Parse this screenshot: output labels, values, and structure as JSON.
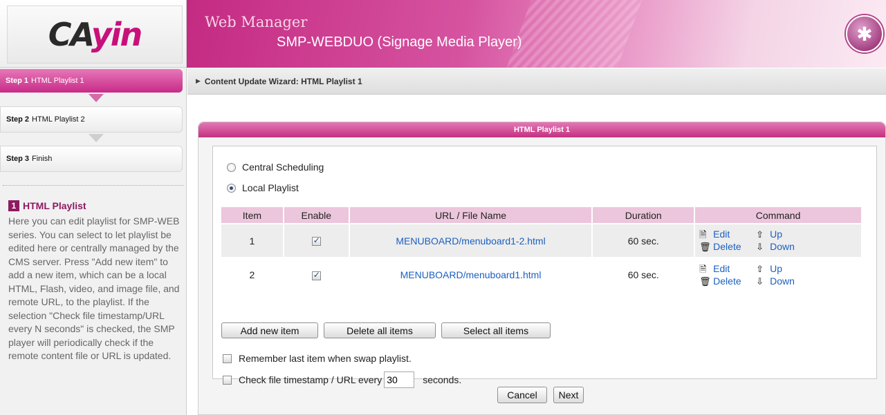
{
  "logo": {
    "text_left": "CA",
    "text_right": "yin"
  },
  "header": {
    "brand": "Web Manager",
    "model": "SMP-WEBDUO (Signage Media Player)",
    "emblem_icon": "cayin-emblem-icon"
  },
  "steps": [
    {
      "num": "Step 1",
      "label": "HTML Playlist 1",
      "active": true
    },
    {
      "num": "Step 2",
      "label": "HTML Playlist 2",
      "active": false
    },
    {
      "num": "Step 3",
      "label": "Finish",
      "active": false
    }
  ],
  "help": {
    "badge": "1",
    "title": "HTML Playlist",
    "body": "Here you can edit playlist for SMP-WEB series. You can select to let playlist be edited here or centrally managed by the CMS server. Press \"Add new item\" to add a new item, which can be a local HTML, Flash, video, and image file, and remote URL, to the playlist. If the selection \"Check file timestamp/URL every N seconds\" is checked, the SMP player will periodically check if the remote content file or URL is updated."
  },
  "breadcrumb": "Content Update Wizard: HTML Playlist 1",
  "panel": {
    "title": "HTML Playlist 1",
    "mode_options": [
      {
        "label": "Central Scheduling",
        "checked": false
      },
      {
        "label": "Local Playlist",
        "checked": true
      }
    ],
    "table": {
      "headers": [
        "Item",
        "Enable",
        "URL / File Name",
        "Duration",
        "Command"
      ],
      "rows": [
        {
          "item": "1",
          "enabled": true,
          "url": "MENUBOARD/menuboard1-2.html",
          "duration": "60 sec."
        },
        {
          "item": "2",
          "enabled": true,
          "url": "MENUBOARD/menuboard1.html",
          "duration": "60 sec."
        }
      ],
      "commands": {
        "edit": "Edit",
        "delete": "Delete",
        "up": "Up",
        "down": "Down"
      }
    },
    "buttons": {
      "add": "Add new item",
      "delete_all": "Delete all items",
      "select_all": "Select all items"
    },
    "remember_label": "Remember last item when swap playlist.",
    "check_label": "Check file timestamp / URL every",
    "check_value": "30",
    "check_unit": "seconds."
  },
  "footer": {
    "cancel": "Cancel",
    "next": "Next"
  },
  "colors": {
    "accent": "#c82a88",
    "link": "#1b5fc1",
    "table_header": "#ecc6dc"
  }
}
